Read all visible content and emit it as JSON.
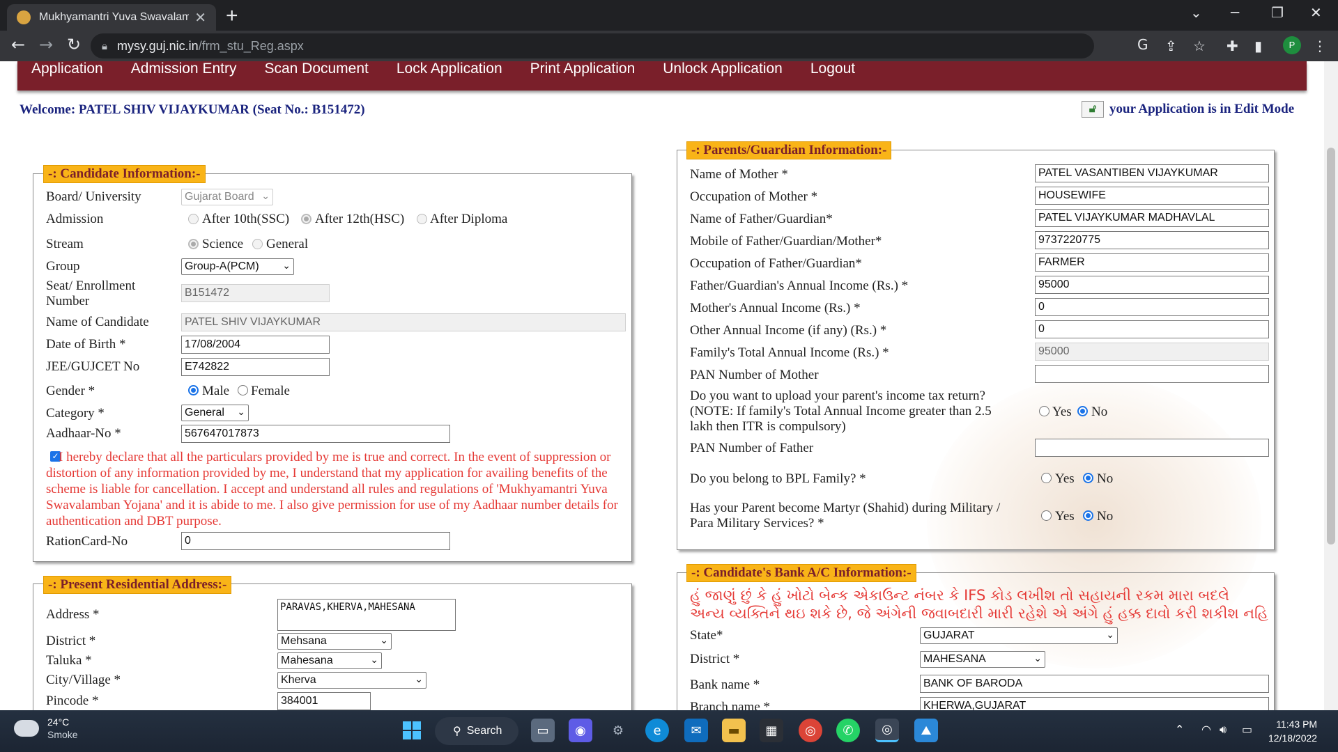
{
  "browser": {
    "tab_title": "Mukhyamantri Yuva Swavalamban",
    "url_host": "mysy.guj.nic.in",
    "url_path": "/frm_stu_Reg.aspx",
    "profile_initial": "P"
  },
  "menu": [
    "Application",
    "Admission Entry",
    "Scan Document",
    "Lock Application",
    "Print Application",
    "Unlock Application",
    "Logout"
  ],
  "welcome": "Welcome: PATEL SHIV VIJAYKUMAR (Seat No.: B151472)",
  "edit_mode": "your Application is in Edit Mode",
  "candidate": {
    "legend": "-: Candidate Information:-",
    "board_label": "Board/ University",
    "board_value": "Gujarat Board",
    "admission_label": "Admission",
    "admission_opts": [
      "After 10th(SSC)",
      "After 12th(HSC)",
      "After Diploma"
    ],
    "stream_label": "Stream",
    "stream_opts": [
      "Science",
      "General"
    ],
    "group_label": "Group",
    "group_value": "Group-A(PCM)",
    "seat_label": "Seat/ Enrollment Number",
    "seat_value": "B151472",
    "name_label": "Name of Candidate",
    "name_value": "PATEL SHIV VIJAYKUMAR",
    "dob_label": "Date of Birth *",
    "dob_value": "17/08/2004",
    "jee_label": "JEE/GUJCET No",
    "jee_value": "E742822",
    "gender_label": "Gender *",
    "gender_opts": [
      "Male",
      "Female"
    ],
    "category_label": "Category *",
    "category_value": "General",
    "aadhaar_label": "Aadhaar-No *",
    "aadhaar_value": "567647017873",
    "declaration": "I hereby declare that all the particulars provided by me is true and correct. In the event of suppression or distortion of any information provided by me, I understand that my application for availing benefits of the scheme is liable for cancellation. I accept and understand all rules and regulations of 'Mukhyamantri Yuva Swavalamban Yojana' and it is abide to me. I also give permission for use of my Aadhaar number details for authentication and DBT purpose.",
    "ration_label": "RationCard-No",
    "ration_value": "0"
  },
  "address": {
    "legend": "-: Present Residential Address:-",
    "address_label": "Address *",
    "address_value": "PARAVAS,KHERVA,MAHESANA",
    "district_label": "District *",
    "district_value": "Mehsana",
    "taluka_label": "Taluka *",
    "taluka_value": "Mahesana",
    "city_label": "City/Village *",
    "city_value": "Kherva",
    "pincode_label": "Pincode *",
    "pincode_value": "384001"
  },
  "parents": {
    "legend": "-: Parents/Guardian Information:-",
    "rows": [
      {
        "label": "Name of Mother *",
        "value": "PATEL VASANTIBEN VIJAYKUMAR"
      },
      {
        "label": "Occupation of Mother *",
        "value": "HOUSEWIFE"
      },
      {
        "label": "Name of Father/Guardian*",
        "value": "PATEL VIJAYKUMAR MADHAVLAL"
      },
      {
        "label": "Mobile of Father/Guardian/Mother*",
        "value": "9737220775"
      },
      {
        "label": "Occupation of Father/Guardian*",
        "value": "FARMER"
      },
      {
        "label": "Father/Guardian's Annual Income (Rs.) *",
        "value": "95000"
      },
      {
        "label": "Mother's Annual Income (Rs.) *",
        "value": "0"
      },
      {
        "label": "Other Annual Income (if any) (Rs.) *",
        "value": "0"
      },
      {
        "label": "Family's Total Annual Income (Rs.) *",
        "value": "95000"
      },
      {
        "label": "PAN Number of Mother",
        "value": ""
      }
    ],
    "itr_question": "Do you want to upload your parent's income tax return? (NOTE: If family's Total Annual Income greater than 2.5 lakh then ITR is compulsory)",
    "pan_father_label": "PAN Number of Father",
    "pan_father_value": "",
    "bpl_question": "Do you belong to BPL Family? *",
    "martyr_question": "Has your Parent become Martyr (Shahid) during Military / Para Military Services? *",
    "yes": "Yes",
    "no": "No"
  },
  "bank": {
    "legend": "-: Candidate's Bank A/C Information:-",
    "note": "હું જાણું છું કે હું ખોટો બેન્ક એકાઉન્ટ નંબર કે IFS કોડ લખીશ તો સહાયની રકમ મારા બદલે અન્ય વ્યક્તિને થઇ શકે છે, જે અંગેની જવાબદારી મારી રહેશે એ અંગે હું હક્ક દાવો કરી શકીશ નહિ",
    "state_label": "State*",
    "state_value": "GUJARAT",
    "district_label": "District *",
    "district_value": "MAHESANA",
    "bank_label": "Bank name *",
    "bank_value": "BANK OF BARODA",
    "branch_label": "Branch name *",
    "branch_value": "KHERWA,GUJARAT"
  },
  "taskbar": {
    "temp": "24°C",
    "weather": "Smoke",
    "search": "Search",
    "time": "11:43 PM",
    "date": "12/18/2022"
  }
}
